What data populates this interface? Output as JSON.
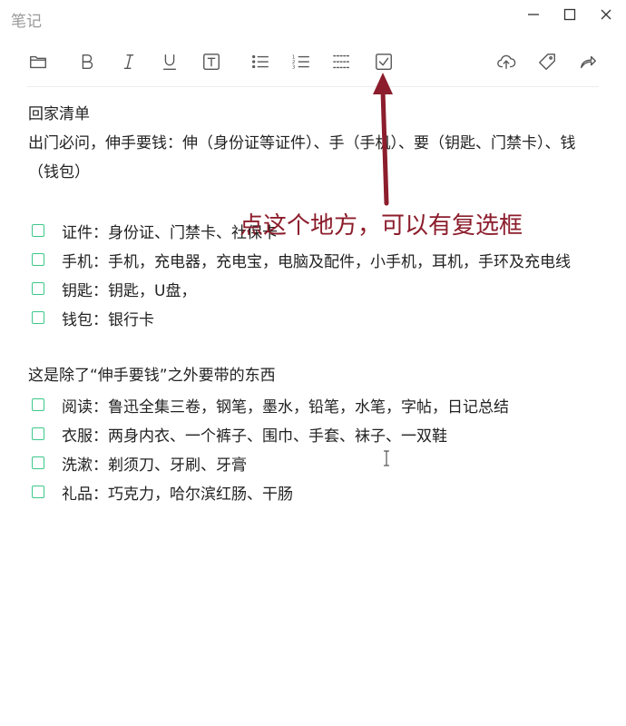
{
  "window": {
    "title": "笔记",
    "controls": [
      "minimize-icon",
      "maximize-icon",
      "close-icon"
    ]
  },
  "toolbar": {
    "left_tools": [
      "folder-icon",
      "bold-icon",
      "italic-icon",
      "underline-icon",
      "text-box-icon",
      "bullet-list-icon",
      "numbered-list-icon",
      "divider-line-icon",
      "checkbox-icon"
    ],
    "right_tools": [
      "cloud-upload-icon",
      "tag-icon",
      "share-icon"
    ]
  },
  "note": {
    "heading": "回家清单",
    "intro": "出门必问，伸手要钱：伸（身份证等证件）、手（手机）、要（钥匙、门禁卡）、钱（钱包）",
    "group1": [
      {
        "text": "证件：身份证、门禁卡、社保卡",
        "checked": false
      },
      {
        "text": "手机：手机，充电器，充电宝，电脑及配件，小手机，耳机，手环及充电线",
        "checked": false
      },
      {
        "text": "钥匙：钥匙，U盘，",
        "checked": false
      },
      {
        "text": "钱包：银行卡",
        "checked": false
      }
    ],
    "section2_title": "这是除了“伸手要钱”之外要带的东西",
    "group2": [
      {
        "text": "阅读：鲁迅全集三卷，钢笔，墨水，铅笔，水笔，字帖，日记总结",
        "checked": false
      },
      {
        "text": "衣服：两身内衣、一个裤子、围巾、手套、袜子、一双鞋",
        "checked": false
      },
      {
        "text": "洗漱：剃须刀、牙刷、牙膏",
        "checked": false
      },
      {
        "text": "礼品：巧克力，哈尔滨红肠、干肠",
        "checked": false
      }
    ]
  },
  "annotation": {
    "text": "点这个地方，可以有复选框",
    "color": "#8c1d2c"
  },
  "colors": {
    "checkbox_border": "#3cc88a",
    "title_text": "#9a9a9a"
  }
}
